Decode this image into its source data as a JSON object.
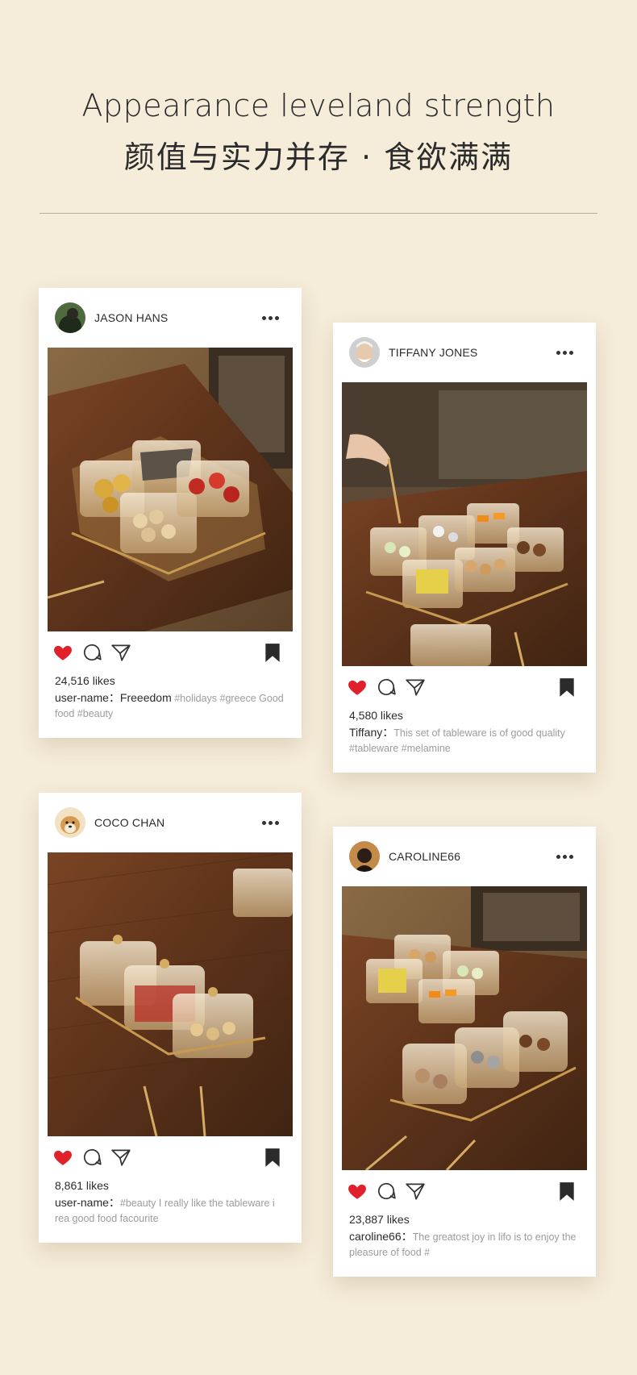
{
  "heading": {
    "title_en": "Appearance leveland strength",
    "title_cn": "颜值与实力并存 · 食欲满满"
  },
  "colors": {
    "background": "#f5ecd9",
    "heart": "#e0202a",
    "text": "#2b2b2b",
    "tag_text": "#9c9c9c"
  },
  "posts": [
    {
      "username": "JASON HANS",
      "likes": "24,516 likes",
      "caption_user": "user-name：",
      "caption_main": "Freeedom",
      "caption_tags": " #holidays #greece Good food #beauty",
      "icons": [
        "heart-icon",
        "comment-icon",
        "share-icon",
        "bookmark-icon",
        "more-icon"
      ]
    },
    {
      "username": "TIFFANY JONES",
      "likes": "4,580 likes",
      "caption_user": "Tiffany：",
      "caption_main": "",
      "caption_tags": "This set of tableware is of good quality #tableware #melamine",
      "icons": [
        "heart-icon",
        "comment-icon",
        "share-icon",
        "bookmark-icon",
        "more-icon"
      ]
    },
    {
      "username": "COCO CHAN",
      "likes": "8,861 likes",
      "caption_user": "user-name：",
      "caption_main": "",
      "caption_tags": "#beauty I really like the tableware i rea good food facourite",
      "icons": [
        "heart-icon",
        "comment-icon",
        "share-icon",
        "bookmark-icon",
        "more-icon"
      ]
    },
    {
      "username": "CAROLINE66",
      "likes": "23,887 likes",
      "caption_user": "caroline66：",
      "caption_main": "",
      "caption_tags": "The greatost joy in lifo is to enjoy the pleasure of food #",
      "icons": [
        "heart-icon",
        "comment-icon",
        "share-icon",
        "bookmark-icon",
        "more-icon"
      ]
    }
  ]
}
